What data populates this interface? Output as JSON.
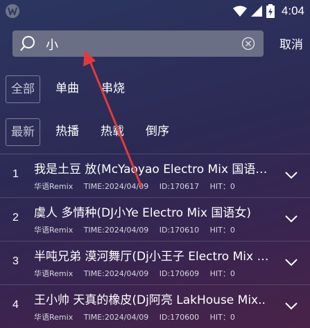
{
  "status_bar": {
    "time": "4:04"
  },
  "search": {
    "query": "小",
    "cancel_label": "取消"
  },
  "filters": {
    "category_tabs": [
      {
        "label": "全部",
        "selected": true
      },
      {
        "label": "单曲",
        "selected": false
      },
      {
        "label": "串烧",
        "selected": false
      }
    ],
    "sort_tabs": [
      {
        "label": "最新",
        "selected": true
      },
      {
        "label": "热播",
        "selected": false
      },
      {
        "label": "热载",
        "selected": false
      },
      {
        "label": "倒序",
        "selected": false
      }
    ]
  },
  "songs": [
    {
      "index": "1",
      "title": "我是土豆 放(McYaoyao Electro Mix 国语女..",
      "genre": "华语Remix",
      "time": "TIME:2024/04/09",
      "id": "ID:170617",
      "hit": "HIT：0"
    },
    {
      "index": "2",
      "title": "虞人 多情种(DJ小Ye Electro Mix 国语女)",
      "genre": "华语Remix",
      "time": "TIME:2024/04/09",
      "id": "ID:170610",
      "hit": "HIT：0"
    },
    {
      "index": "3",
      "title": "半吨兄弟 漠河舞厅(Dj小王子 Electro Mix 国..",
      "genre": "华语Remix",
      "time": "TIME:2024/04/09",
      "id": "ID:170609",
      "hit": "HIT：0"
    },
    {
      "index": "4",
      "title": "王小帅 天真的橡皮(Dj阿亮 LakHouse Mix..",
      "genre": "华语Remix",
      "time": "TIME:2024/04/09",
      "id": "ID:170600",
      "hit": "HIT：0"
    }
  ],
  "colors": {
    "annotation_arrow": "#e23a3a",
    "search_box": "#6b6f85"
  }
}
